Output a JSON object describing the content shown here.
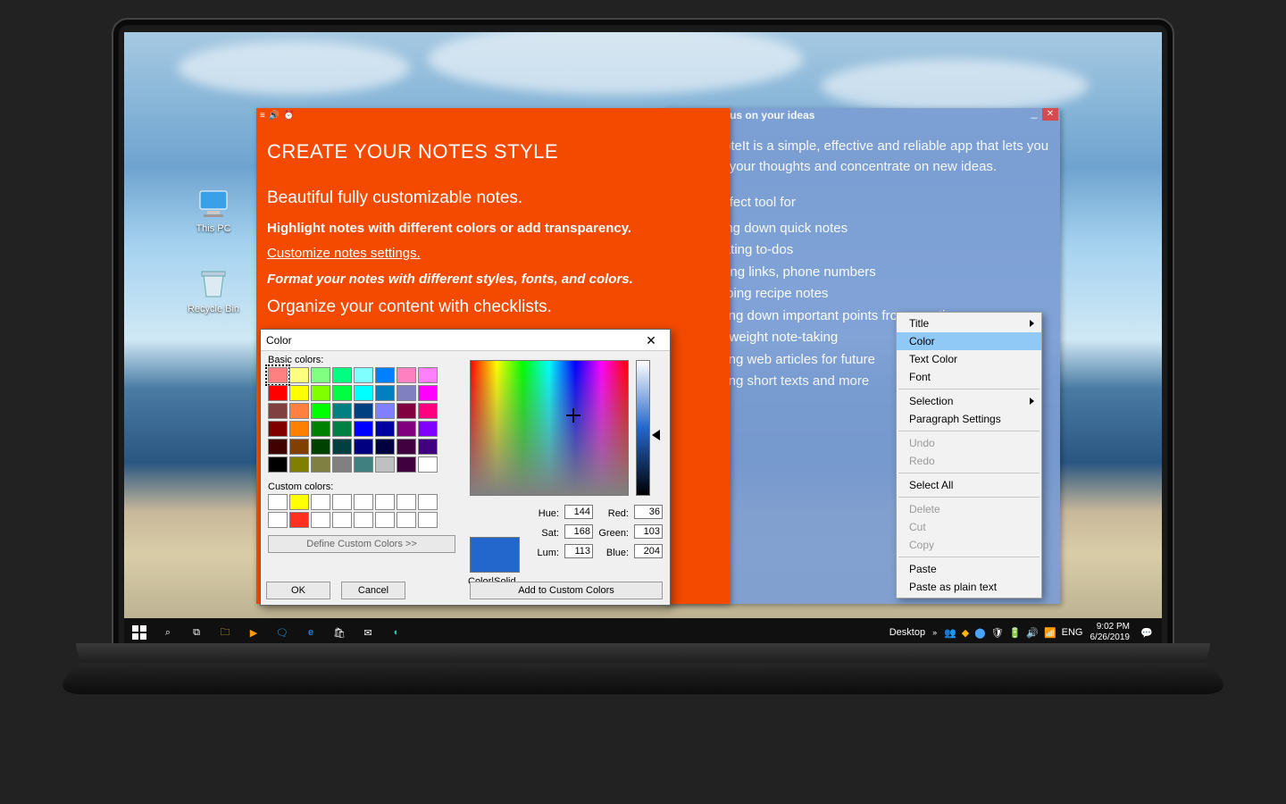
{
  "desktop": {
    "icons": [
      {
        "label": "This PC"
      },
      {
        "label": "Recycle Bin"
      }
    ]
  },
  "note_orange": {
    "heading": "CREATE YOUR NOTES STYLE",
    "line_beautiful": "Beautiful fully customizable notes.",
    "line_highlight": "Highlight notes with different colors or add transparency.",
    "line_customize": "Customize notes settings.",
    "line_format": "Format your notes with different styles, fonts, and colors.",
    "line_organize": "Organize your content with checklists."
  },
  "note_blue": {
    "title": "Focus on your ideas",
    "intro": "    JustNoteIt is a simple, effective and reliable app that lets you organize your thoughts and concentrate on new ideas.",
    "perfect": "It is a perfect tool for",
    "bullets": [
      "jotting down quick notes",
      "creating to-dos",
      "adding links, phone numbers",
      "keeping recipe notes",
      "writing down important points from meetings",
      "lightweight note-taking",
      "saving web articles for future",
      "writing short texts and more"
    ]
  },
  "color_dialog": {
    "title": "Color",
    "basic_label": "Basic colors:",
    "custom_label": "Custom colors:",
    "define_btn": "Define Custom Colors >>",
    "ok": "OK",
    "cancel": "Cancel",
    "color_solid": "Color|Solid",
    "add_custom": "Add to Custom Colors",
    "hue_label": "Hue:",
    "hue": "144",
    "sat_label": "Sat:",
    "sat": "168",
    "lum_label": "Lum:",
    "lum": "113",
    "red_label": "Red:",
    "red": "36",
    "green_label": "Green:",
    "green": "103",
    "blue_label": "Blue:",
    "blue": "204",
    "basic_swatches": [
      "#ff8080",
      "#ffff80",
      "#80ff80",
      "#00ff80",
      "#80ffff",
      "#0080ff",
      "#ff80c0",
      "#ff80ff",
      "#ff0000",
      "#ffff00",
      "#80ff00",
      "#00ff40",
      "#00ffff",
      "#0080c0",
      "#8080c0",
      "#ff00ff",
      "#804040",
      "#ff8040",
      "#00ff00",
      "#008080",
      "#004080",
      "#8080ff",
      "#800040",
      "#ff0080",
      "#800000",
      "#ff8000",
      "#008000",
      "#008040",
      "#0000ff",
      "#0000a0",
      "#800080",
      "#8000ff",
      "#400000",
      "#804000",
      "#004000",
      "#004040",
      "#000080",
      "#000040",
      "#400040",
      "#400080",
      "#000000",
      "#808000",
      "#808040",
      "#808080",
      "#408080",
      "#c0c0c0",
      "#400040",
      "#ffffff"
    ],
    "custom_swatches": [
      "#ffffff",
      "#ffff00",
      "#ffffff",
      "#ffffff",
      "#ffffff",
      "#ffffff",
      "#ffffff",
      "#ffffff",
      "#ffffff",
      "#ff3020",
      "#ffffff",
      "#ffffff",
      "#ffffff",
      "#ffffff",
      "#ffffff",
      "#ffffff"
    ]
  },
  "context_menu": {
    "items": [
      {
        "label": "Title",
        "arrow": true,
        "enabled": true
      },
      {
        "label": "Color",
        "hover": true,
        "enabled": true
      },
      {
        "label": "Text Color",
        "enabled": true
      },
      {
        "label": "Font",
        "enabled": true
      },
      {
        "sep": true
      },
      {
        "label": "Selection",
        "arrow": true,
        "enabled": true
      },
      {
        "label": "Paragraph Settings",
        "enabled": true
      },
      {
        "sep": true
      },
      {
        "label": "Undo",
        "enabled": false
      },
      {
        "label": "Redo",
        "enabled": false
      },
      {
        "sep": true
      },
      {
        "label": "Select All",
        "enabled": true
      },
      {
        "sep": true
      },
      {
        "label": "Delete",
        "enabled": false
      },
      {
        "label": "Cut",
        "enabled": false
      },
      {
        "label": "Copy",
        "enabled": false
      },
      {
        "sep": true
      },
      {
        "label": "Paste",
        "enabled": true
      },
      {
        "label": "Paste as plain text",
        "enabled": true
      }
    ]
  },
  "taskbar": {
    "desktop_toolbar": "Desktop",
    "lang": "ENG",
    "time": "9:02 PM",
    "date": "6/26/2019"
  }
}
